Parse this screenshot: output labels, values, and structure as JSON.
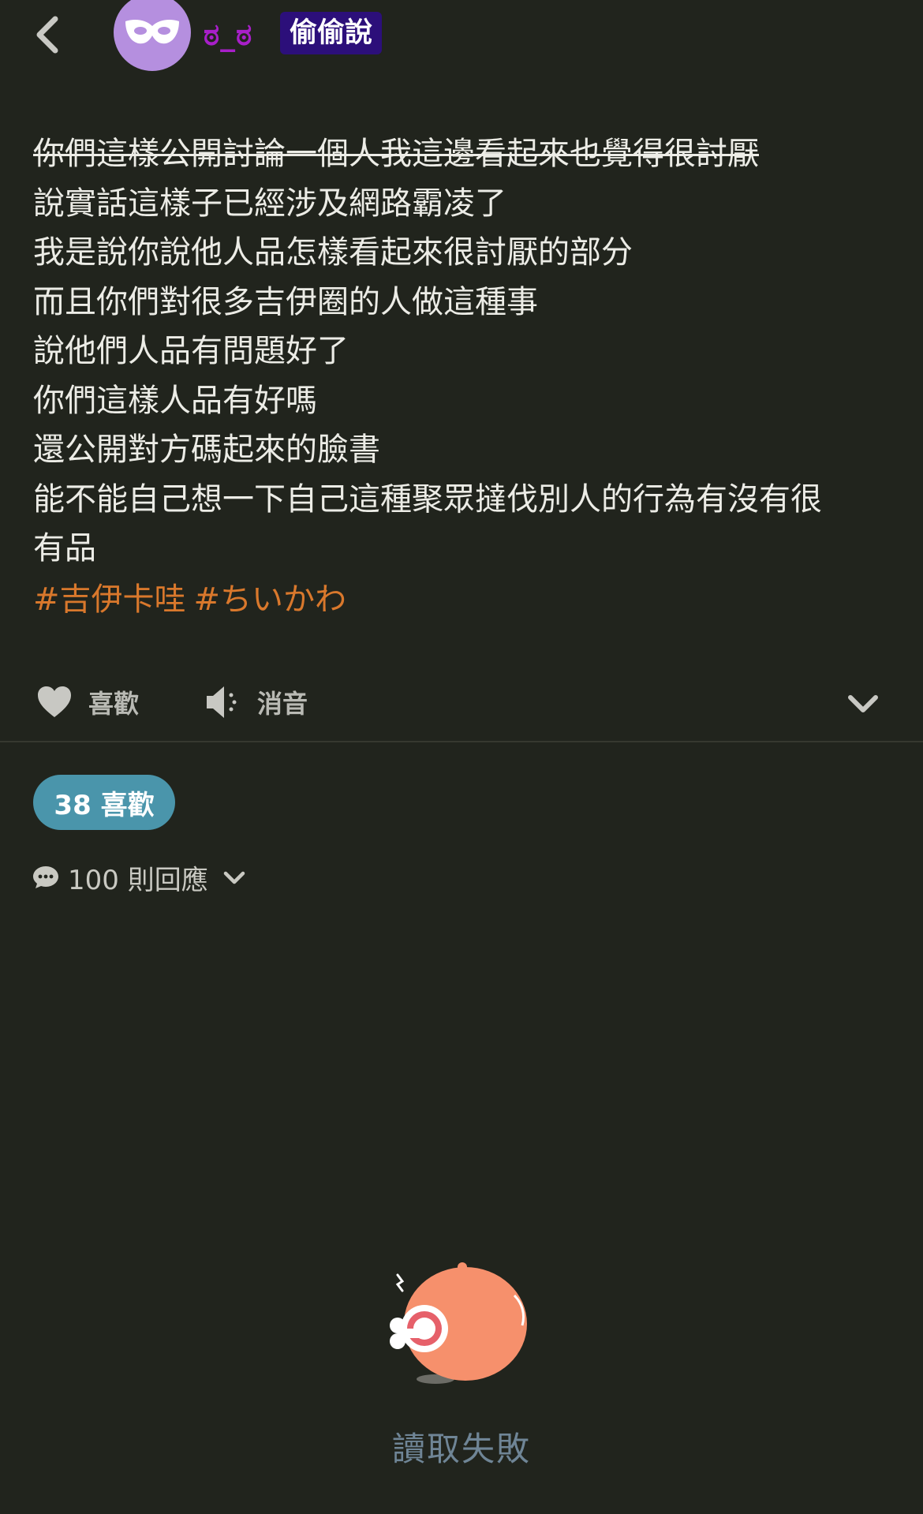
{
  "header": {
    "username": "ಠ_ಠ",
    "board_badge": "偷偷說"
  },
  "post": {
    "struck_line": "你們這樣公開討論一個人我這邊看起來也覺得很討厭",
    "lines": [
      "說實話這樣子已經涉及網路霸凌了",
      "我是說你說他人品怎樣看起來很討厭的部分",
      "而且你們對很多吉伊圈的人做這種事",
      "說他們人品有問題好了",
      "你們這樣人品有好嗎",
      "還公開對方碼起來的臉書",
      "能不能自己想一下自己這種聚眾撻伐別人的行為有沒有很",
      "有品"
    ],
    "tags": [
      "#吉伊卡哇",
      "#ちいかわ"
    ]
  },
  "actions": {
    "like_label": "喜歡",
    "mute_label": "消音"
  },
  "stats": {
    "likes_label": "38 喜歡",
    "comments_label": "100 則回應"
  },
  "error": {
    "message": "讀取失敗"
  },
  "colors": {
    "background": "#21241d",
    "username": "#a81fc9",
    "badge": "#2c0f7a",
    "tags": "#d9782c",
    "likes_pill": "#4a95ab",
    "error_text": "#6f8596"
  }
}
